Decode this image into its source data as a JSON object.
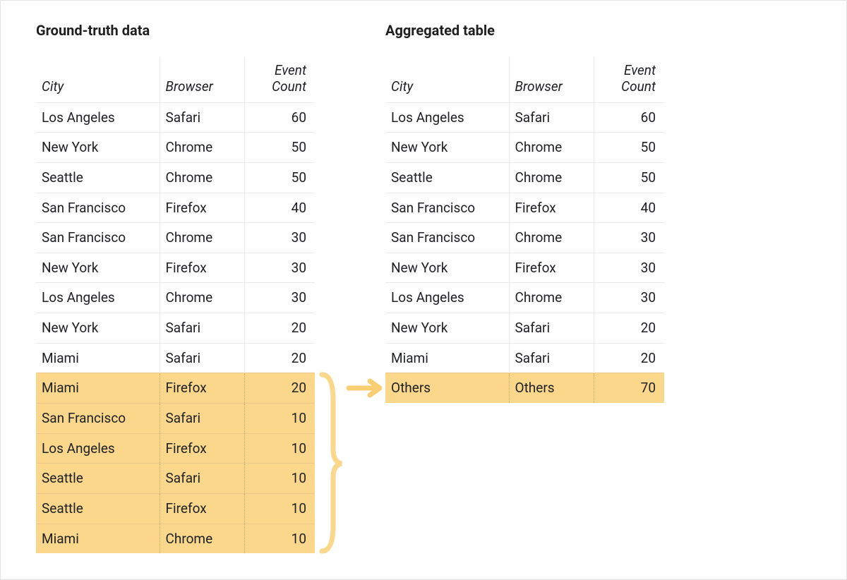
{
  "left": {
    "title": "Ground-truth data",
    "headers": {
      "city": "City",
      "browser": "Browser",
      "count": "Event Count"
    },
    "rows": [
      {
        "city": "Los Angeles",
        "browser": "Safari",
        "count": 60,
        "hl": false
      },
      {
        "city": "New York",
        "browser": "Chrome",
        "count": 50,
        "hl": false
      },
      {
        "city": "Seattle",
        "browser": "Chrome",
        "count": 50,
        "hl": false
      },
      {
        "city": "San Francisco",
        "browser": "Firefox",
        "count": 40,
        "hl": false
      },
      {
        "city": "San Francisco",
        "browser": "Chrome",
        "count": 30,
        "hl": false
      },
      {
        "city": "New York",
        "browser": "Firefox",
        "count": 30,
        "hl": false
      },
      {
        "city": "Los Angeles",
        "browser": "Chrome",
        "count": 30,
        "hl": false
      },
      {
        "city": "New York",
        "browser": "Safari",
        "count": 20,
        "hl": false
      },
      {
        "city": "Miami",
        "browser": "Safari",
        "count": 20,
        "hl": false
      },
      {
        "city": "Miami",
        "browser": "Firefox",
        "count": 20,
        "hl": true
      },
      {
        "city": "San Francisco",
        "browser": "Safari",
        "count": 10,
        "hl": true
      },
      {
        "city": "Los Angeles",
        "browser": "Firefox",
        "count": 10,
        "hl": true
      },
      {
        "city": "Seattle",
        "browser": "Safari",
        "count": 10,
        "hl": true
      },
      {
        "city": "Seattle",
        "browser": "Firefox",
        "count": 10,
        "hl": true
      },
      {
        "city": "Miami",
        "browser": "Chrome",
        "count": 10,
        "hl": true
      }
    ]
  },
  "right": {
    "title": "Aggregated table",
    "headers": {
      "city": "City",
      "browser": "Browser",
      "count": "Event Count"
    },
    "rows": [
      {
        "city": "Los Angeles",
        "browser": "Safari",
        "count": 60,
        "hl": false
      },
      {
        "city": "New York",
        "browser": "Chrome",
        "count": 50,
        "hl": false
      },
      {
        "city": "Seattle",
        "browser": "Chrome",
        "count": 50,
        "hl": false
      },
      {
        "city": "San Francisco",
        "browser": "Firefox",
        "count": 40,
        "hl": false
      },
      {
        "city": "San Francisco",
        "browser": "Chrome",
        "count": 30,
        "hl": false
      },
      {
        "city": "New York",
        "browser": "Firefox",
        "count": 30,
        "hl": false
      },
      {
        "city": "Los Angeles",
        "browser": "Chrome",
        "count": 30,
        "hl": false
      },
      {
        "city": "New York",
        "browser": "Safari",
        "count": 20,
        "hl": false
      },
      {
        "city": "Miami",
        "browser": "Safari",
        "count": 20,
        "hl": false
      },
      {
        "city": "Others",
        "browser": "Others",
        "count": 70,
        "hl": true
      }
    ]
  },
  "colors": {
    "highlight": "#fad78b",
    "arrow": "#f9cf73"
  }
}
